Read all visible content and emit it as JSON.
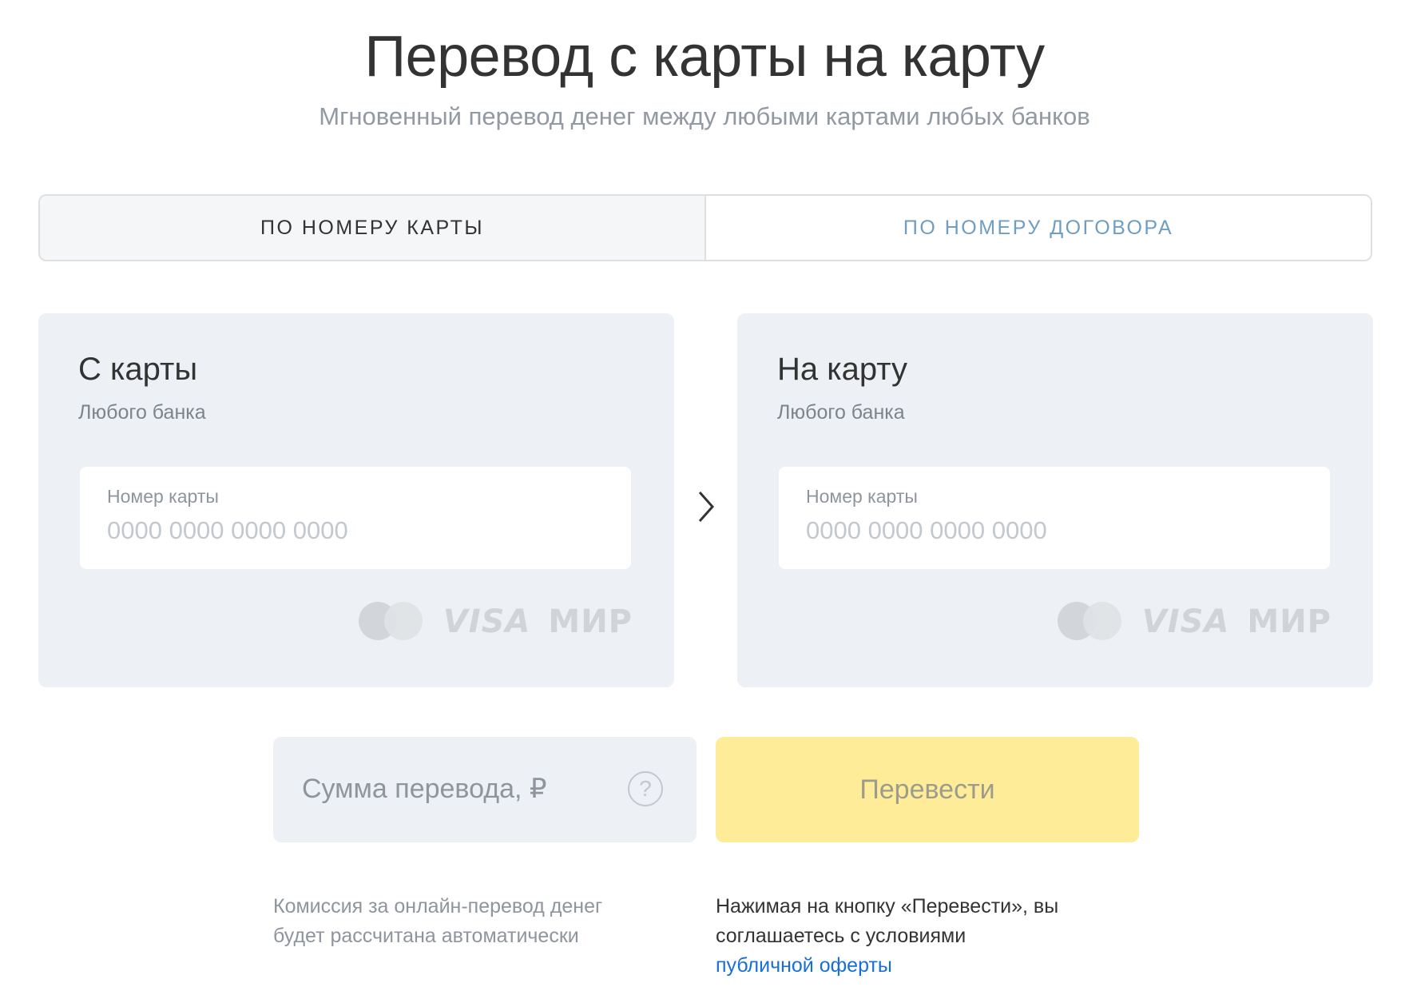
{
  "header": {
    "title": "Перевод с карты на карту",
    "subtitle": "Мгновенный перевод денег между любыми картами любых банков"
  },
  "tabs": [
    {
      "label": "ПО НОМЕРУ КАРТЫ",
      "active": true
    },
    {
      "label": "ПО НОМЕРУ ДОГОВОРА",
      "active": false
    }
  ],
  "from_card": {
    "title": "С карты",
    "subtitle": "Любого банка",
    "field_label": "Номер карты",
    "placeholder": "0000 0000 0000 0000"
  },
  "to_card": {
    "title": "На карту",
    "subtitle": "Любого банка",
    "field_label": "Номер карты",
    "placeholder": "0000 0000 0000 0000"
  },
  "payment_logos": {
    "visa": "VISA",
    "mir": "МИР"
  },
  "amount": {
    "placeholder": "Сумма перевода, ₽",
    "help": "?"
  },
  "submit_label": "Перевести",
  "commission_note": "Комиссия за онлайн-перевод денег будет рассчитана автоматически",
  "agreement": {
    "text": "Нажимая на кнопку «Перевести», вы соглашаетесь с условиями",
    "link": "публичной оферты"
  },
  "colors": {
    "accent_yellow": "#ffec99",
    "link_blue": "#1770d6",
    "card_bg": "#edf0f4",
    "inactive_tab": "#6f9ec1"
  }
}
